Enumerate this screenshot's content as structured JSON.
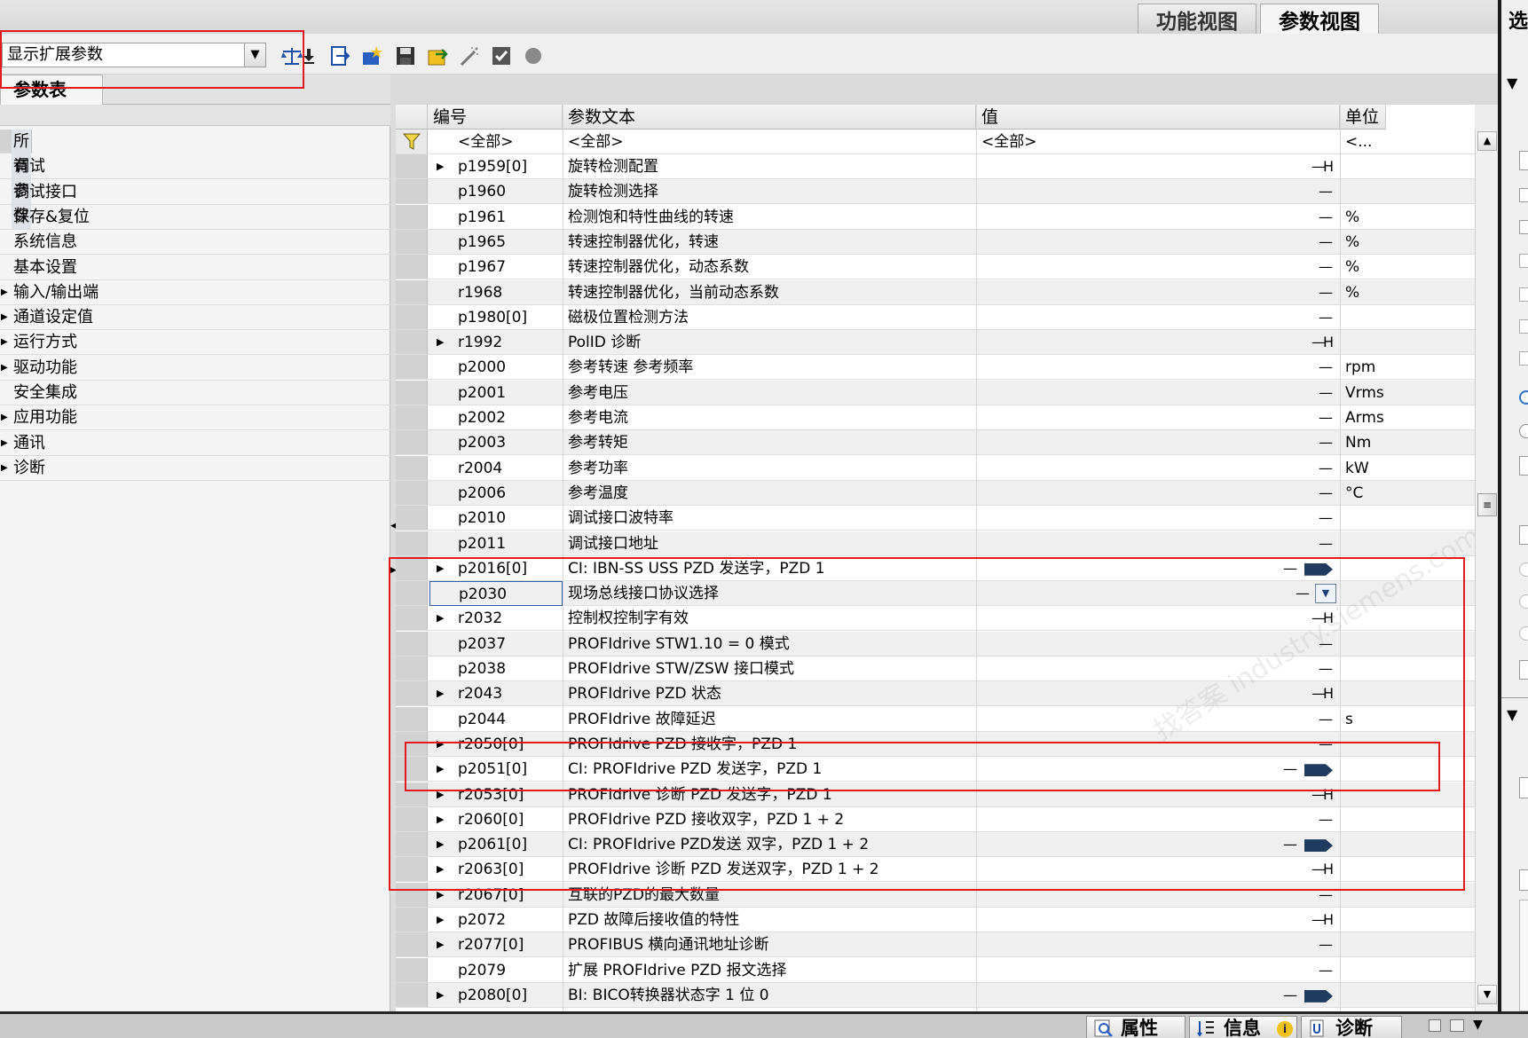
{
  "view_tabs": {
    "function_view": "功能视图",
    "parameter_view": "参数视图"
  },
  "right_panel": {
    "cut_title": "选"
  },
  "toolbar": {
    "filter_value": "显示扩展参数",
    "icons": [
      "scale-icon",
      "download-icon",
      "export-icon",
      "new-icon",
      "save-icon",
      "open-icon",
      "wand-icon",
      "checkbox-icon",
      "circle-icon"
    ]
  },
  "table_tab": "参数表",
  "tree": [
    {
      "label": "所有参数",
      "expandable": false,
      "selected": true
    },
    {
      "label": "调试",
      "expandable": false
    },
    {
      "label": "调试接口",
      "expandable": false
    },
    {
      "label": "保存&复位",
      "expandable": false
    },
    {
      "label": "系统信息",
      "expandable": false
    },
    {
      "label": "基本设置",
      "expandable": false
    },
    {
      "label": "输入/输出端",
      "expandable": true
    },
    {
      "label": "通道设定值",
      "expandable": true
    },
    {
      "label": "运行方式",
      "expandable": true
    },
    {
      "label": "驱动功能",
      "expandable": true
    },
    {
      "label": "安全集成",
      "expandable": false
    },
    {
      "label": "应用功能",
      "expandable": true
    },
    {
      "label": "通讯",
      "expandable": true
    },
    {
      "label": "诊断",
      "expandable": true
    }
  ],
  "columns": {
    "number": "编号",
    "text": "参数文本",
    "value": "值",
    "unit": "单位"
  },
  "filter_row": {
    "number": "<全部>",
    "text": "<全部>",
    "value": "<全部>",
    "unit": "<..."
  },
  "rows": [
    {
      "num": "p1959[0]",
      "text": "旋转检测配置",
      "val": "H",
      "unit": "",
      "expand": true,
      "kind": "H"
    },
    {
      "num": "p1960",
      "text": "旋转检测选择",
      "val": "",
      "unit": "",
      "expand": false,
      "kind": "dash"
    },
    {
      "num": "p1961",
      "text": "检测饱和特性曲线的转速",
      "val": "",
      "unit": "%",
      "expand": false,
      "kind": "dash"
    },
    {
      "num": "p1965",
      "text": "转速控制器优化，转速",
      "val": "",
      "unit": "%",
      "expand": false,
      "kind": "dash"
    },
    {
      "num": "p1967",
      "text": "转速控制器优化，动态系数",
      "val": "",
      "unit": "%",
      "expand": false,
      "kind": "dash"
    },
    {
      "num": "r1968",
      "text": "转速控制器优化，当前动态系数",
      "val": "",
      "unit": "%",
      "expand": false,
      "kind": "dash"
    },
    {
      "num": "p1980[0]",
      "text": "磁极位置检测方法",
      "val": "",
      "unit": "",
      "expand": false,
      "kind": "dash"
    },
    {
      "num": "r1992",
      "text": "PolID 诊断",
      "val": "H",
      "unit": "",
      "expand": true,
      "kind": "H"
    },
    {
      "num": "p2000",
      "text": "参考转速 参考频率",
      "val": "",
      "unit": "rpm",
      "expand": false,
      "kind": "dash"
    },
    {
      "num": "p2001",
      "text": "参考电压",
      "val": "",
      "unit": "Vrms",
      "expand": false,
      "kind": "dash"
    },
    {
      "num": "p2002",
      "text": "参考电流",
      "val": "",
      "unit": "Arms",
      "expand": false,
      "kind": "dash"
    },
    {
      "num": "p2003",
      "text": "参考转矩",
      "val": "",
      "unit": "Nm",
      "expand": false,
      "kind": "dash"
    },
    {
      "num": "r2004",
      "text": "参考功率",
      "val": "",
      "unit": "kW",
      "expand": false,
      "kind": "dash"
    },
    {
      "num": "p2006",
      "text": "参考温度",
      "val": "",
      "unit": "°C",
      "expand": false,
      "kind": "dash"
    },
    {
      "num": "p2010",
      "text": "调试接口波特率",
      "val": "",
      "unit": "",
      "expand": false,
      "kind": "dash"
    },
    {
      "num": "p2011",
      "text": "调试接口地址",
      "val": "",
      "unit": "",
      "expand": false,
      "kind": "dash"
    },
    {
      "num": "p2016[0]",
      "text": "CI: IBN-SS USS PZD 发送字，PZD 1",
      "val": "",
      "unit": "",
      "expand": true,
      "kind": "bico"
    },
    {
      "num": "p2030",
      "text": "现场总线接口协议选择",
      "val": "",
      "unit": "",
      "expand": false,
      "kind": "combo"
    },
    {
      "num": "r2032",
      "text": "控制权控制字有效",
      "val": "H",
      "unit": "",
      "expand": true,
      "kind": "H"
    },
    {
      "num": "p2037",
      "text": "PROFIdrive STW1.10 = 0 模式",
      "val": "",
      "unit": "",
      "expand": false,
      "kind": "dash"
    },
    {
      "num": "p2038",
      "text": "PROFIdrive STW/ZSW 接口模式",
      "val": "",
      "unit": "",
      "expand": false,
      "kind": "dash"
    },
    {
      "num": "r2043",
      "text": "PROFIdrive PZD 状态",
      "val": "H",
      "unit": "",
      "expand": true,
      "kind": "H"
    },
    {
      "num": "p2044",
      "text": "PROFIdrive 故障延迟",
      "val": "",
      "unit": "s",
      "expand": false,
      "kind": "dash"
    },
    {
      "num": "r2050[0]",
      "text": "PROFIdrive PZD 接收字，PZD 1",
      "val": "",
      "unit": "",
      "expand": true,
      "kind": "dash"
    },
    {
      "num": "p2051[0]",
      "text": "CI: PROFIdrive PZD 发送字，PZD 1",
      "val": "",
      "unit": "",
      "expand": true,
      "kind": "bico"
    },
    {
      "num": "r2053[0]",
      "text": "PROFIdrive 诊断 PZD 发送字，PZD 1",
      "val": "H",
      "unit": "",
      "expand": true,
      "kind": "H"
    },
    {
      "num": "r2060[0]",
      "text": "PROFIdrive PZD 接收双字，PZD 1 + 2",
      "val": "",
      "unit": "",
      "expand": true,
      "kind": "dash"
    },
    {
      "num": "p2061[0]",
      "text": "CI: PROFIdrive PZD发送 双字，PZD 1 + 2",
      "val": "",
      "unit": "",
      "expand": true,
      "kind": "bico"
    },
    {
      "num": "r2063[0]",
      "text": "PROFIdrive 诊断 PZD 发送双字，PZD 1 + 2",
      "val": "H",
      "unit": "",
      "expand": true,
      "kind": "H"
    },
    {
      "num": "r2067[0]",
      "text": "互联的PZD的最大数量",
      "val": "",
      "unit": "",
      "expand": true,
      "kind": "dash"
    },
    {
      "num": "p2072",
      "text": "PZD 故障后接收值的特性",
      "val": "H",
      "unit": "",
      "expand": true,
      "kind": "H"
    },
    {
      "num": "r2077[0]",
      "text": "PROFIBUS 横向通讯地址诊断",
      "val": "",
      "unit": "",
      "expand": true,
      "kind": "dash"
    },
    {
      "num": "p2079",
      "text": "扩展 PROFIdrive  PZD 报文选择",
      "val": "",
      "unit": "",
      "expand": false,
      "kind": "dash"
    },
    {
      "num": "p2080[0]",
      "text": "BI: BICO转换器状态字 1 位 0",
      "val": "",
      "unit": "",
      "expand": true,
      "kind": "bico"
    }
  ],
  "bottom_tabs": {
    "properties": "属性",
    "info": "信息",
    "diagnostics": "诊断"
  },
  "watermark": "找答案 industry.siemens.com/cs",
  "colors": {
    "annotation_red": "#e3191c",
    "bico_arrow": "#1f3b5e",
    "selection_border": "#2b5fa8"
  }
}
